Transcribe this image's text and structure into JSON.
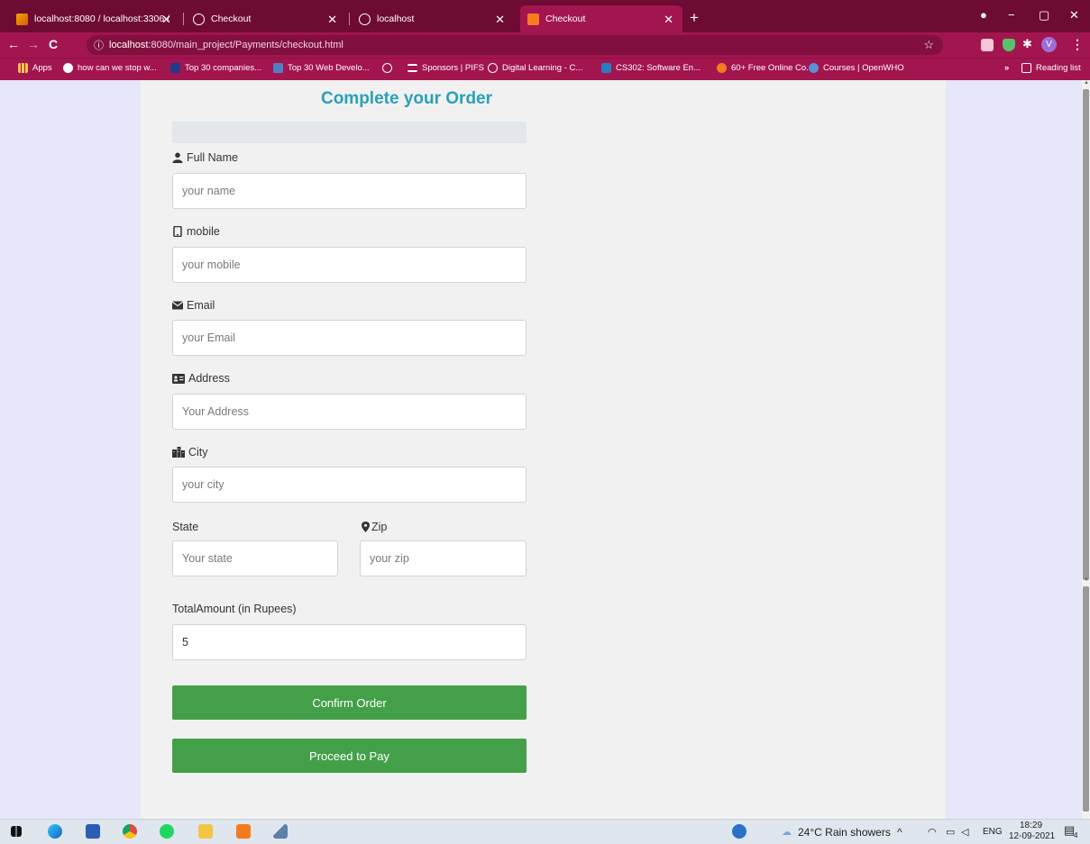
{
  "browser": {
    "tabs": [
      {
        "title": "localhost:8080 / localhost:3306 /"
      },
      {
        "title": "Checkout"
      },
      {
        "title": "localhost"
      },
      {
        "title": "Checkout"
      }
    ],
    "new_tab": "+",
    "url_host": "localhost",
    "url_path": ":8080/main_project/Payments/checkout.html",
    "bookmarks": [
      "Apps",
      "how can we stop w...",
      "Top 30 companies...",
      "Top 30 Web Develo...",
      "",
      "Sponsors | PIFS",
      "Digital Learning - C...",
      "CS302: Software En...",
      "60+ Free Online Co...",
      "Courses | OpenWHO"
    ],
    "more_bookmarks": "»",
    "reading_list": "Reading list",
    "profile_initial": "V",
    "accent_color": "#a3154f"
  },
  "form": {
    "title": "Complete your Order",
    "fields": {
      "name": {
        "label": "Full Name",
        "placeholder": "your name",
        "icon": "user-icon"
      },
      "mobile": {
        "label": "mobile",
        "placeholder": "your mobile",
        "icon": "mobile-icon"
      },
      "email": {
        "label": "Email",
        "placeholder": "your Email",
        "icon": "envelope-icon"
      },
      "address": {
        "label": "Address",
        "placeholder": "Your Address",
        "icon": "address-card-icon"
      },
      "city": {
        "label": "City",
        "placeholder": "your city",
        "icon": "building-icon"
      },
      "state": {
        "label": "State",
        "placeholder": "Your state"
      },
      "zip": {
        "label": "Zip",
        "placeholder": "your zip",
        "icon": "map-marker-icon"
      },
      "amount": {
        "label": "TotalAmount (in Rupees)",
        "value": "5"
      }
    },
    "confirm_button": "Confirm Order",
    "pay_button": "Proceed to Pay",
    "title_color": "#2aa0b9",
    "button_color": "#44a048"
  },
  "taskbar": {
    "weather": "24°C  Rain showers",
    "language": "ENG",
    "time": "18:29",
    "date": "12-09-2021",
    "notifications": "4"
  }
}
